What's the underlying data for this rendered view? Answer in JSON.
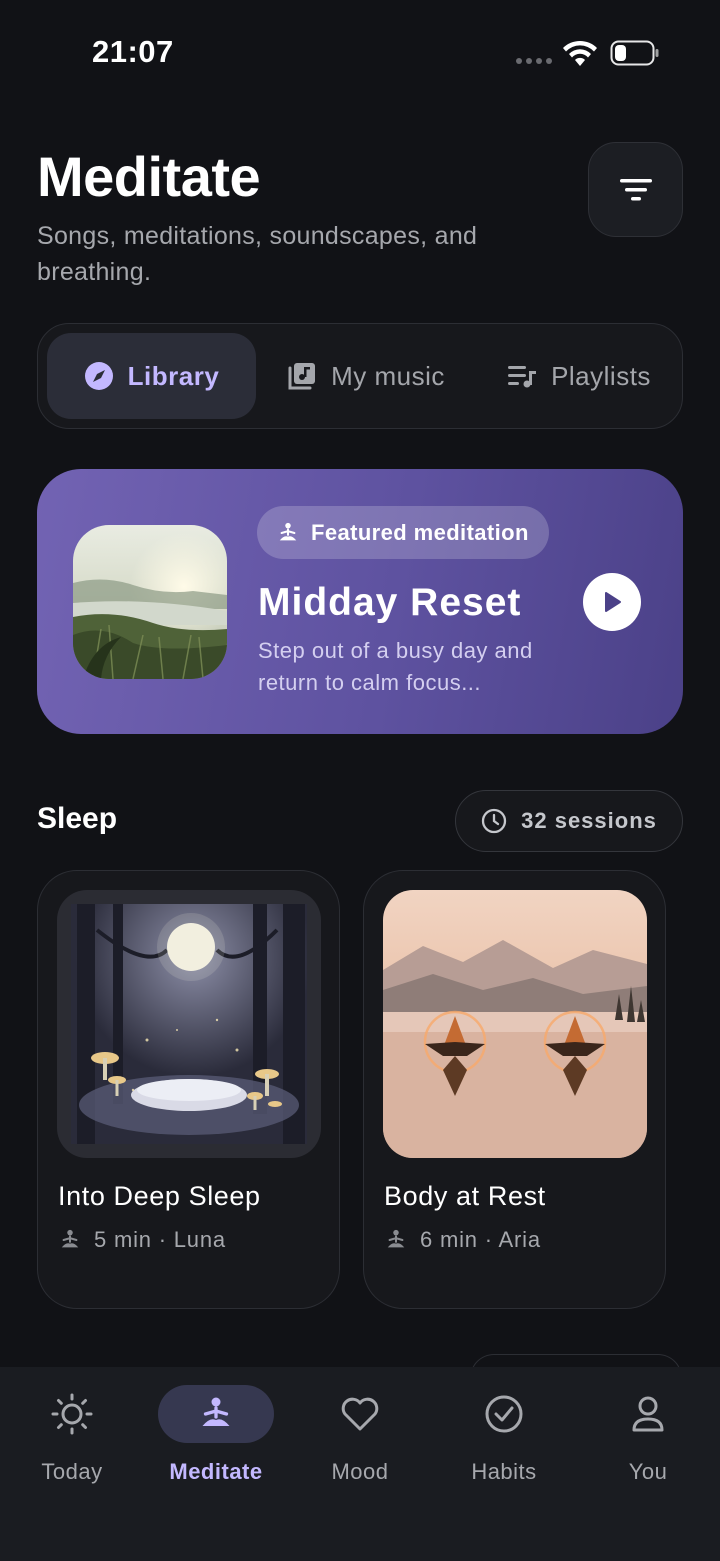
{
  "status_bar": {
    "time": "21:07"
  },
  "header": {
    "title": "Meditate",
    "subtitle": "Songs, meditations, soundscapes, and breathing."
  },
  "tabs": [
    {
      "label": "Library",
      "icon": "compass-icon",
      "active": true
    },
    {
      "label": "My music",
      "icon": "music-library-icon",
      "active": false
    },
    {
      "label": "Playlists",
      "icon": "playlist-icon",
      "active": false
    }
  ],
  "featured": {
    "badge": "Featured meditation",
    "title": "Midday Reset",
    "description": "Step out of a busy day and return to calm focus..."
  },
  "section": {
    "title": "Sleep",
    "sessions": "32 sessions",
    "cards": [
      {
        "title": "Into Deep Sleep",
        "meta": "5 min · Luna"
      },
      {
        "title": "Body at Rest",
        "meta": "6 min · Aria"
      }
    ]
  },
  "nav": [
    {
      "label": "Today",
      "icon": "sun-icon"
    },
    {
      "label": "Meditate",
      "icon": "meditate-icon",
      "active": true
    },
    {
      "label": "Mood",
      "icon": "heart-icon"
    },
    {
      "label": "Habits",
      "icon": "check-circle-icon"
    },
    {
      "label": "You",
      "icon": "person-icon"
    }
  ],
  "colors": {
    "background": "#111216",
    "accent": "#c3b8ff",
    "featured_gradient_start": "#7263b3",
    "featured_gradient_end": "#4b4188"
  }
}
